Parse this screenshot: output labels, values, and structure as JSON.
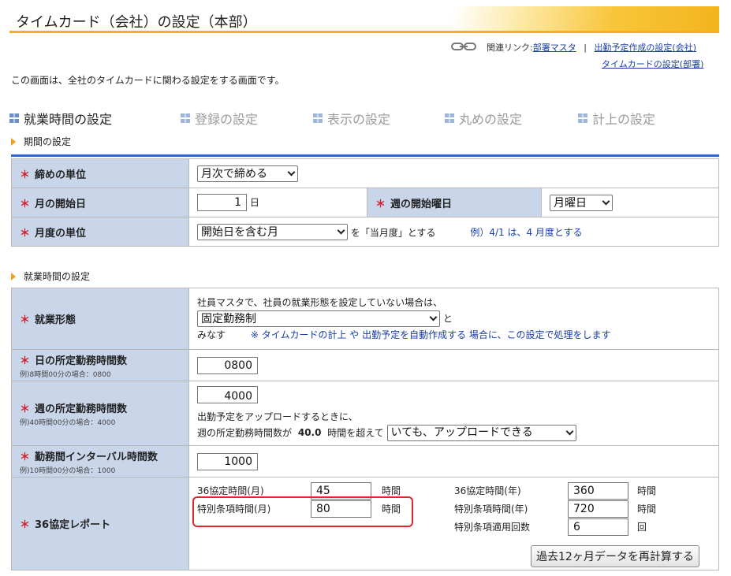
{
  "page_title": "タイムカード（会社）の設定（本部）",
  "related": {
    "label": "関連リンク:",
    "links": [
      "部署マスタ",
      "出勤予定作成の設定(会社)",
      "タイムカードの設定(部署)"
    ],
    "separator": "|"
  },
  "intro": "この画面は、全社のタイムカードに関わる設定をする画面です。",
  "tabs": [
    "就業時間の設定",
    "登録の設定",
    "表示の設定",
    "丸めの設定",
    "計上の設定"
  ],
  "section1": {
    "heading": "期間の設定",
    "closing_unit": {
      "label": "締めの単位",
      "value": "月次で締める"
    },
    "month_start": {
      "label": "月の開始日",
      "value": "1",
      "suffix": "日"
    },
    "week_start": {
      "label": "週の開始曜日",
      "value": "月曜日"
    },
    "month_unit": {
      "label": "月度の単位",
      "value": "開始日を含む月",
      "suffix": "を「当月度」とする",
      "example": "例）4/1 は、4 月度とする"
    }
  },
  "section2": {
    "heading": "就業時間の設定",
    "work_type": {
      "label": "就業形態",
      "line1": "社員マスタで、社員の就業形態を設定していない場合は、",
      "value": "固定勤務制",
      "after_select": "と",
      "line3_prefix": "みなす",
      "note": "※ タイムカードの計上 や 出勤予定を自動作成する 場合に、この設定で処理をします"
    },
    "daily_hours": {
      "label": "日の所定勤務時間数",
      "sub": "例)8時間00分の場合：0800",
      "value": "0800"
    },
    "weekly_hours": {
      "label": "週の所定勤務時間数",
      "sub": "例)40時間00分の場合：4000",
      "value": "4000",
      "line1": "出勤予定をアップロードするときに、",
      "line2_prefix": "週の所定勤務時間数が",
      "line2_value": "40.0",
      "line2_suffix": "時間を超えて",
      "select_value": "いても、アップロードできる"
    },
    "interval": {
      "label": "勤務間インターバル時間数",
      "sub": "例)10時間00分の場合：1000",
      "value": "1000"
    },
    "report36": {
      "label": "36協定レポート",
      "monthly_label": "36協定時間(月)",
      "monthly_value": "45",
      "monthly_unit": "時間",
      "special_monthly_label": "特別条項時間(月)",
      "special_monthly_value": "80",
      "special_monthly_unit": "時間",
      "yearly_label": "36協定時間(年)",
      "yearly_value": "360",
      "yearly_unit": "時間",
      "special_yearly_label": "特別条項時間(年)",
      "special_yearly_value": "720",
      "special_yearly_unit": "時間",
      "special_count_label": "特別条項適用回数",
      "special_count_value": "6",
      "special_count_unit": "回",
      "recalc_button": "過去12ヶ月データを再計算する"
    }
  },
  "required_mark": "＊",
  "colors": {
    "accent_bar": "#f2b21e",
    "label_bg": "#c9d6ea",
    "required": "#d0202a",
    "link": "#1a3ea8",
    "highlight": "#e2242b"
  }
}
